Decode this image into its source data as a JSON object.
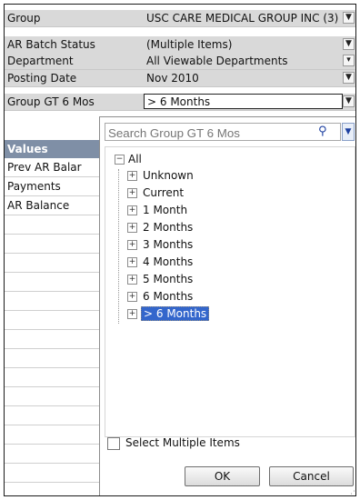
{
  "filters": [
    {
      "label": "Group",
      "value": "USC CARE MEDICAL GROUP INC (3)",
      "icon": "funnel-icon"
    },
    {
      "label": "AR Batch Status",
      "value": "(Multiple Items)",
      "icon": "funnel-icon"
    },
    {
      "label": "Department",
      "value": "All Viewable Departments",
      "icon": "dropdown-arrow-icon"
    },
    {
      "label": "Posting Date",
      "value": "Nov 2010",
      "icon": "funnel-icon"
    },
    {
      "label": "Group GT 6 Mos",
      "value": "> 6 Months",
      "icon": "funnel-icon"
    }
  ],
  "values_header": "Values",
  "value_rows": [
    "Prev AR Balar",
    "Payments",
    "AR Balance"
  ],
  "dropdown": {
    "search_placeholder": "Search Group GT 6 Mos",
    "root_label": "All",
    "items": [
      "Unknown",
      "Current",
      "1 Month",
      "2 Months",
      "3 Months",
      "4 Months",
      "5 Months",
      "6 Months",
      "> 6 Months"
    ],
    "selected_item": "> 6 Months",
    "multi_select_label": "Select Multiple Items",
    "multi_select_checked": false,
    "ok_label": "OK",
    "cancel_label": "Cancel"
  },
  "colors": {
    "values_header_bg": "#7f8fa6",
    "filter_row_bg": "#d9d9d9",
    "selection_bg": "#3366cc"
  }
}
